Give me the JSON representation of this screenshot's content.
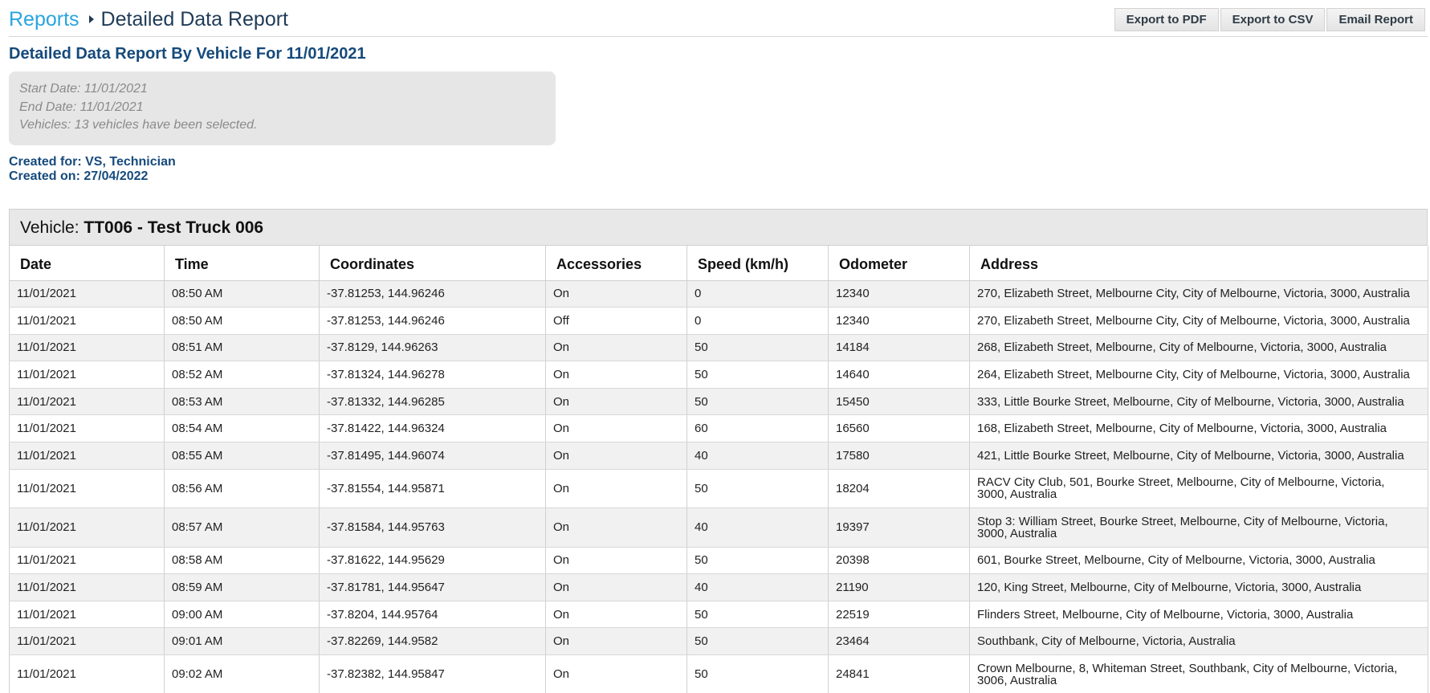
{
  "breadcrumb": {
    "root": "Reports",
    "current": "Detailed Data Report"
  },
  "toolbar": {
    "export_pdf": "Export to PDF",
    "export_csv": "Export to CSV",
    "email": "Email Report"
  },
  "report": {
    "title": "Detailed Data Report By Vehicle For 11/01/2021",
    "criteria": {
      "start_date": "Start Date: 11/01/2021",
      "end_date": "End Date: 11/01/2021",
      "vehicles": "Vehicles: 13 vehicles have been selected."
    },
    "created_for": "Created for: VS, Technician",
    "created_on": "Created on: 27/04/2022"
  },
  "vehicle": {
    "label": "Vehicle: ",
    "name": "TT006 - Test Truck 006"
  },
  "table": {
    "headers": [
      "Date",
      "Time",
      "Coordinates",
      "Accessories",
      "Speed (km/h)",
      "Odometer",
      "Address"
    ],
    "rows": [
      [
        "11/01/2021",
        "08:50 AM",
        "-37.81253, 144.96246",
        "On",
        "0",
        "12340",
        "270, Elizabeth Street, Melbourne City, City of Melbourne, Victoria, 3000, Australia"
      ],
      [
        "11/01/2021",
        "08:50 AM",
        "-37.81253, 144.96246",
        "Off",
        "0",
        "12340",
        "270, Elizabeth Street, Melbourne City, City of Melbourne, Victoria, 3000, Australia"
      ],
      [
        "11/01/2021",
        "08:51 AM",
        "-37.8129, 144.96263",
        "On",
        "50",
        "14184",
        "268, Elizabeth Street, Melbourne, City of Melbourne, Victoria, 3000, Australia"
      ],
      [
        "11/01/2021",
        "08:52 AM",
        "-37.81324, 144.96278",
        "On",
        "50",
        "14640",
        "264, Elizabeth Street, Melbourne City, City of Melbourne, Victoria, 3000, Australia"
      ],
      [
        "11/01/2021",
        "08:53 AM",
        "-37.81332, 144.96285",
        "On",
        "50",
        "15450",
        "333, Little Bourke Street, Melbourne, City of Melbourne, Victoria, 3000, Australia"
      ],
      [
        "11/01/2021",
        "08:54 AM",
        "-37.81422, 144.96324",
        "On",
        "60",
        "16560",
        "168, Elizabeth Street, Melbourne, City of Melbourne, Victoria, 3000, Australia"
      ],
      [
        "11/01/2021",
        "08:55 AM",
        "-37.81495, 144.96074",
        "On",
        "40",
        "17580",
        "421, Little Bourke Street, Melbourne, City of Melbourne, Victoria, 3000, Australia"
      ],
      [
        "11/01/2021",
        "08:56 AM",
        "-37.81554, 144.95871",
        "On",
        "50",
        "18204",
        "RACV City Club, 501, Bourke Street, Melbourne, City of Melbourne, Victoria, 3000, Australia"
      ],
      [
        "11/01/2021",
        "08:57 AM",
        "-37.81584, 144.95763",
        "On",
        "40",
        "19397",
        "Stop 3: William Street, Bourke Street, Melbourne, City of Melbourne, Victoria, 3000, Australia"
      ],
      [
        "11/01/2021",
        "08:58 AM",
        "-37.81622, 144.95629",
        "On",
        "50",
        "20398",
        "601, Bourke Street, Melbourne, City of Melbourne, Victoria, 3000, Australia"
      ],
      [
        "11/01/2021",
        "08:59 AM",
        "-37.81781, 144.95647",
        "On",
        "40",
        "21190",
        "120, King Street, Melbourne, City of Melbourne, Victoria, 3000, Australia"
      ],
      [
        "11/01/2021",
        "09:00 AM",
        "-37.8204, 144.95764",
        "On",
        "50",
        "22519",
        "Flinders Street, Melbourne, City of Melbourne, Victoria, 3000, Australia"
      ],
      [
        "11/01/2021",
        "09:01 AM",
        "-37.82269, 144.9582",
        "On",
        "50",
        "23464",
        "Southbank, City of Melbourne, Victoria, Australia"
      ],
      [
        "11/01/2021",
        "09:02 AM",
        "-37.82382, 144.95847",
        "On",
        "50",
        "24841",
        "Crown Melbourne, 8, Whiteman Street, Southbank, City of Melbourne, Victoria, 3006, Australia"
      ]
    ]
  }
}
